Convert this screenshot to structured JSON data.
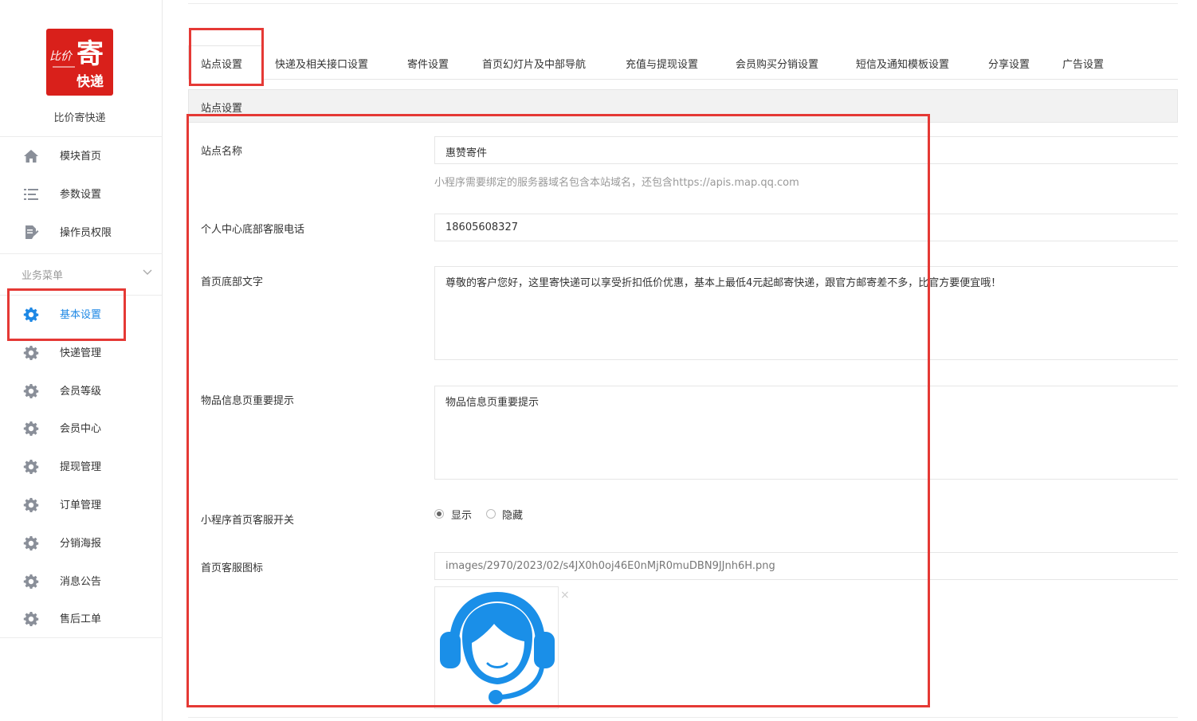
{
  "brand": {
    "logo_text_small": "比价",
    "logo_text_big": "寄",
    "logo_text_bottom": "快递",
    "name": "比价寄快递",
    "color": "#d9201b"
  },
  "sidebar": {
    "top_items": [
      {
        "label": "模块首页",
        "icon": "home-icon"
      },
      {
        "label": "参数设置",
        "icon": "list-icon"
      },
      {
        "label": "操作员权限",
        "icon": "document-edit-icon"
      }
    ],
    "group_title": "业务菜单",
    "group_items": [
      {
        "label": "基本设置",
        "icon": "gear-icon",
        "active": true
      },
      {
        "label": "快递管理",
        "icon": "gear-icon"
      },
      {
        "label": "会员等级",
        "icon": "gear-icon"
      },
      {
        "label": "会员中心",
        "icon": "gear-icon"
      },
      {
        "label": "提现管理",
        "icon": "gear-icon"
      },
      {
        "label": "订单管理",
        "icon": "gear-icon"
      },
      {
        "label": "分销海报",
        "icon": "gear-icon"
      },
      {
        "label": "消息公告",
        "icon": "gear-icon"
      },
      {
        "label": "售后工单",
        "icon": "gear-icon"
      }
    ],
    "active_color": "#1e88e5"
  },
  "tabs": [
    {
      "label": "站点设置",
      "active": true
    },
    {
      "label": "快递及相关接口设置"
    },
    {
      "label": "寄件设置"
    },
    {
      "label": "首页幻灯片及中部导航"
    },
    {
      "label": "充值与提现设置"
    },
    {
      "label": "会员购买分销设置"
    },
    {
      "label": "短信及通知模板设置"
    },
    {
      "label": "分享设置"
    },
    {
      "label": "广告设置"
    }
  ],
  "panel": {
    "title": "站点设置"
  },
  "form": {
    "site_name": {
      "label": "站点名称",
      "value": "惠赞寄件",
      "help": "小程序需要绑定的服务器域名包含本站域名，还包含https://apis.map.qq.com"
    },
    "phone": {
      "label": "个人中心底部客服电话",
      "value": "18605608327"
    },
    "footer_text": {
      "label": "首页底部文字",
      "value": "尊敬的客户您好，这里寄快递可以享受折扣低价优惠，基本上最低4元起邮寄快递，跟官方邮寄差不多，比官方要便宜哦！"
    },
    "item_tip": {
      "label": "物品信息页重要提示",
      "value": "物品信息页重要提示"
    },
    "service_switch": {
      "label": "小程序首页客服开关",
      "options": [
        "显示",
        "隐藏"
      ],
      "selected": "显示"
    },
    "service_icon": {
      "label": "首页客服图标",
      "value": "images/2970/2023/02/s4JX0h0oj46E0nMjR0muDBN9JJnh6H.png",
      "close": "×",
      "icon": "customer-service-headset-icon",
      "icon_color": "#1a8fe8"
    }
  },
  "highlight_color": "#e53935"
}
